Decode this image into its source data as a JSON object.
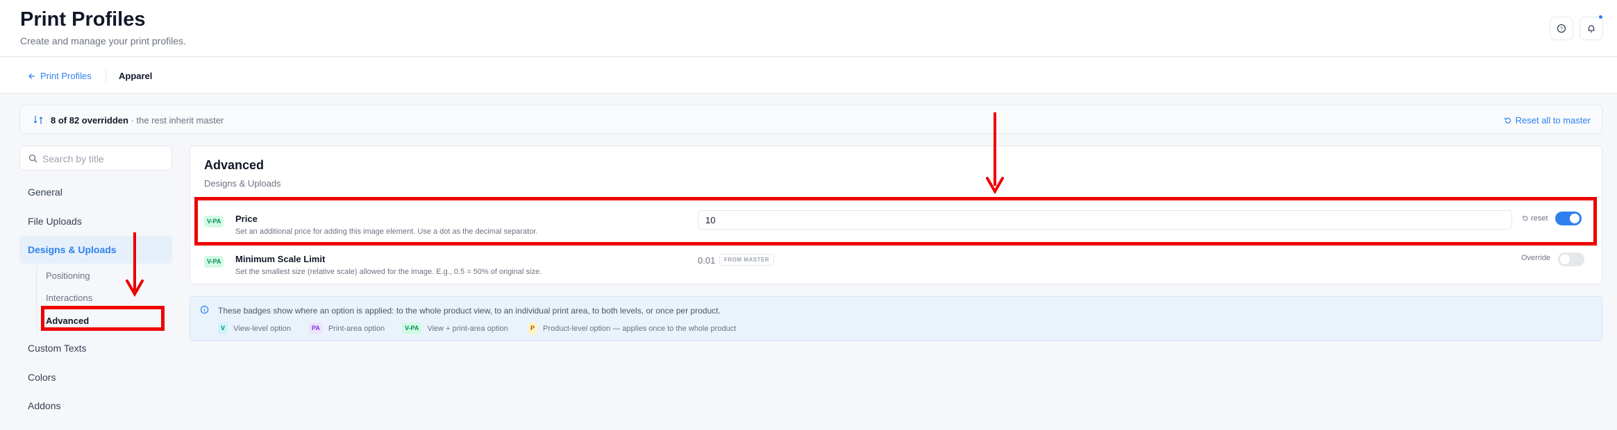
{
  "header": {
    "title": "Print Profiles",
    "subtitle": "Create and manage your print profiles."
  },
  "breadcrumb": {
    "back": "Print Profiles",
    "current": "Apparel"
  },
  "overrides": {
    "count": "8 of 82 overridden",
    "rest": " · the rest inherit master",
    "reset_all": "Reset all to master"
  },
  "search": {
    "placeholder": "Search by title"
  },
  "sidebar": {
    "items": [
      {
        "label": "General"
      },
      {
        "label": "File Uploads"
      },
      {
        "label": "Designs & Uploads"
      },
      {
        "label": "Custom Texts"
      },
      {
        "label": "Colors"
      },
      {
        "label": "Addons"
      }
    ],
    "subitems": [
      {
        "label": "Positioning"
      },
      {
        "label": "Interactions"
      },
      {
        "label": "Advanced"
      }
    ]
  },
  "panel": {
    "title": "Advanced",
    "subtitle": "Designs & Uploads",
    "options": [
      {
        "badge": "V-PA",
        "title": "Price",
        "description": "Set an additional price for adding this image element. Use a dot as the decimal separator.",
        "value": "10",
        "reset": "reset",
        "override_on": true
      },
      {
        "badge": "V-PA",
        "title": "Minimum Scale Limit",
        "description": "Set the smallest size (relative scale) allowed for the image. E.g., 0.5 = 50% of original size.",
        "value": "0.01",
        "source": "FROM MASTER",
        "override_label": "Override",
        "override_on": false
      }
    ]
  },
  "info": {
    "text": "These badges show where an option is applied: to the whole product view, to an individual print area, to both levels, or once per product.",
    "legend": [
      {
        "badge": "V",
        "label": "View-level option"
      },
      {
        "badge": "PA",
        "label": "Print-area option"
      },
      {
        "badge": "V-PA",
        "label": "View + print-area option"
      },
      {
        "badge": "P",
        "label": "Product-level option — applies once to the whole product"
      }
    ]
  },
  "colors": {
    "accent": "#2f80ed",
    "annotation": "#ee0000"
  }
}
